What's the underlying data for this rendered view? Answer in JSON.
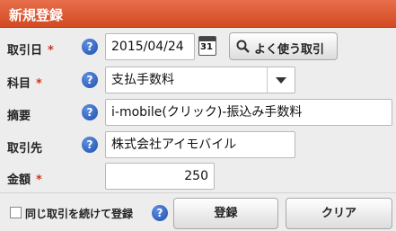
{
  "title": "新規登録",
  "required_mark": "*",
  "help_glyph": "?",
  "date": {
    "label": "取引日",
    "value": "2015/04/24",
    "calendar_day": "31",
    "frequent_button": "よく使う取引"
  },
  "subject": {
    "label": "科目",
    "value": "支払手数料"
  },
  "summary": {
    "label": "摘要",
    "value": "i-mobile(クリック)-振込み手数料"
  },
  "partner": {
    "label": "取引先",
    "value": "株式会社アイモバイル"
  },
  "amount": {
    "label": "金額",
    "value": "250"
  },
  "footer": {
    "continue_label": "同じ取引を続けて登録",
    "register_button": "登録",
    "clear_button": "クリア"
  },
  "colors": {
    "title_bar": "#d9532a",
    "required": "#d0341e",
    "help_icon": "#2a5bbd"
  }
}
